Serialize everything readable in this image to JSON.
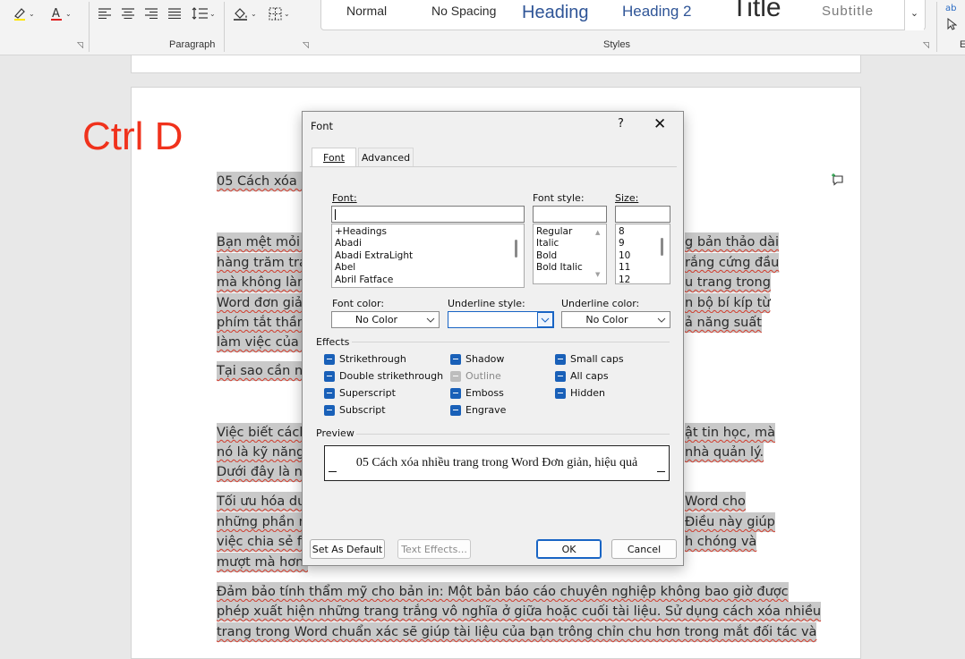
{
  "ribbon": {
    "paragraph_label": "Paragraph",
    "styles_label": "Styles",
    "styles": [
      "Normal",
      "No Spacing",
      "Heading",
      "Heading 2",
      "Title",
      "Subtitle"
    ],
    "edge_label": "E"
  },
  "overlay_label": "Ctrl D",
  "document": {
    "lines": [
      {
        "left": "05 Cách xóa n",
        "right": ""
      },
      {
        "left": "Bạn mệt mỏi v",
        "right": "g bản thảo dài"
      },
      {
        "left": "hàng trăm tran",
        "right": "rắng cứng đầu"
      },
      {
        "left": "mà không làm",
        "right": "u trang trong"
      },
      {
        "left": "Word đơn giản",
        "right": "n bộ bí kíp từ"
      },
      {
        "left": "phím tắt thần",
        "right": "ả năng suất"
      },
      {
        "left": "làm việc của b",
        "right": ""
      },
      {
        "left": "Tại sao cần nắ",
        "right": ""
      },
      {
        "left": "Việc biết cách",
        "right": "ật tin học, mà"
      },
      {
        "left": "nó là kỹ năng",
        "right": "nhà quản lý."
      },
      {
        "left": "Dưới đây là nh",
        "right": ""
      },
      {
        "left": "Tối ưu hóa dun",
        "right": "Word cho"
      },
      {
        "left": "những phần n",
        "right": "Điều này giúp"
      },
      {
        "left": "việc chia sẻ fil",
        "right": "h chóng và"
      },
      {
        "left": "mượt mà hơn.",
        "right": ""
      }
    ],
    "full_lines": [
      "Đảm bảo tính thẩm mỹ cho bản in: Một bản báo cáo chuyên nghiệp không bao giờ được",
      "phép xuất hiện những trang trắng vô nghĩa ở giữa hoặc cuối tài liệu. Sử dụng cách xóa nhiều",
      "trang trong Word chuẩn xác sẽ giúp tài liệu của bạn trông chỉn chu hơn trong mắt đối tác và"
    ]
  },
  "dialog": {
    "title": "Font",
    "help": "?",
    "close": "✕",
    "tabs": {
      "font": "Font",
      "advanced": "Advanced"
    },
    "font_label": "Font:",
    "font_value": "",
    "font_list": [
      "+Headings",
      "Abadi",
      "Abadi ExtraLight",
      "Abel",
      "Abril Fatface"
    ],
    "style_label": "Font style:",
    "style_list": [
      "Regular",
      "Italic",
      "Bold",
      "Bold Italic"
    ],
    "size_label": "Size:",
    "size_list": [
      "8",
      "9",
      "10",
      "11",
      "12"
    ],
    "font_color_label": "Font color:",
    "font_color_value": "No Color",
    "underline_style_label": "Underline style:",
    "underline_style_value": "",
    "underline_color_label": "Underline color:",
    "underline_color_value": "No Color",
    "effects_title": "Effects",
    "effects": {
      "strikethrough": "Strikethrough",
      "double_strikethrough": "Double strikethrough",
      "superscript": "Superscript",
      "subscript": "Subscript",
      "shadow": "Shadow",
      "outline": "Outline",
      "emboss": "Emboss",
      "engrave": "Engrave",
      "small_caps": "Small caps",
      "all_caps": "All caps",
      "hidden": "Hidden"
    },
    "preview_title": "Preview",
    "preview_text": "05 Cách xóa nhiều trang trong Word Đơn giản, hiệu quả",
    "buttons": {
      "set_default": "Set As Default",
      "text_effects": "Text Effects...",
      "ok": "OK",
      "cancel": "Cancel"
    }
  }
}
